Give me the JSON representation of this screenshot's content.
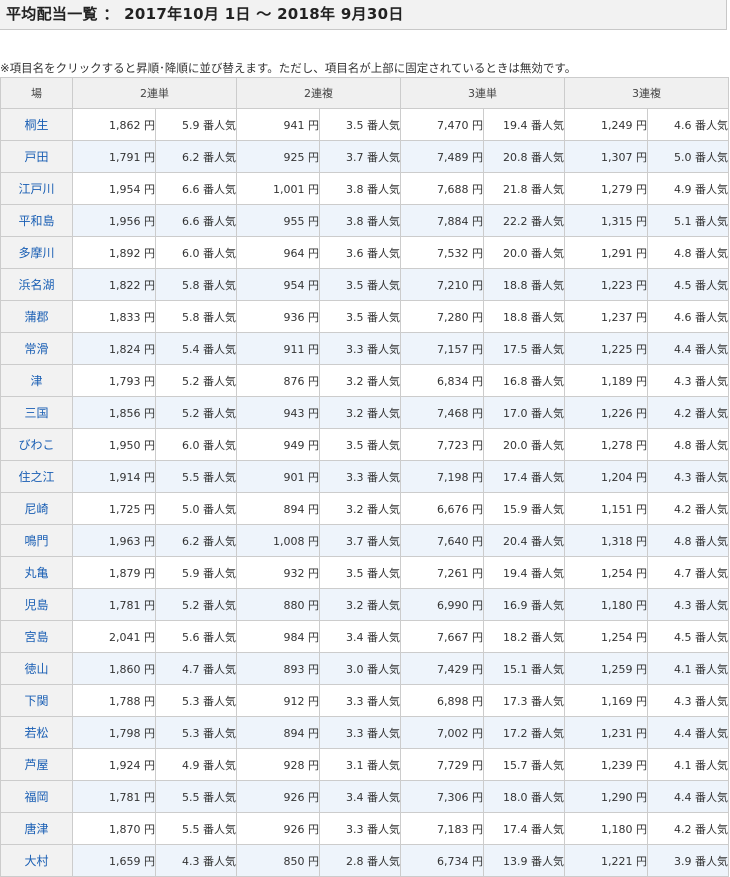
{
  "page": {
    "title": "平均配当一覧 ： 2017年10月 1日 ～ 2018年 9月30日",
    "note": "※項目名をクリックすると昇順･降順に並び替えます。ただし、項目名が上部に固定されているときは無効です。"
  },
  "table": {
    "headers": {
      "venue": "場",
      "t2": "2連単",
      "f2": "2連複",
      "t3": "3連単",
      "f3": "3連複"
    },
    "yen": "円",
    "pop_suffix": "番人気",
    "rows": [
      {
        "venue": "桐生",
        "t2_amt": "1,862",
        "t2_pop": "5.9",
        "f2_amt": "941",
        "f2_pop": "3.5",
        "t3_amt": "7,470",
        "t3_pop": "19.4",
        "f3_amt": "1,249",
        "f3_pop": "4.6"
      },
      {
        "venue": "戸田",
        "t2_amt": "1,791",
        "t2_pop": "6.2",
        "f2_amt": "925",
        "f2_pop": "3.7",
        "t3_amt": "7,489",
        "t3_pop": "20.8",
        "f3_amt": "1,307",
        "f3_pop": "5.0"
      },
      {
        "venue": "江戸川",
        "t2_amt": "1,954",
        "t2_pop": "6.6",
        "f2_amt": "1,001",
        "f2_pop": "3.8",
        "t3_amt": "7,688",
        "t3_pop": "21.8",
        "f3_amt": "1,279",
        "f3_pop": "4.9"
      },
      {
        "venue": "平和島",
        "t2_amt": "1,956",
        "t2_pop": "6.6",
        "f2_amt": "955",
        "f2_pop": "3.8",
        "t3_amt": "7,884",
        "t3_pop": "22.2",
        "f3_amt": "1,315",
        "f3_pop": "5.1"
      },
      {
        "venue": "多摩川",
        "t2_amt": "1,892",
        "t2_pop": "6.0",
        "f2_amt": "964",
        "f2_pop": "3.6",
        "t3_amt": "7,532",
        "t3_pop": "20.0",
        "f3_amt": "1,291",
        "f3_pop": "4.8"
      },
      {
        "venue": "浜名湖",
        "t2_amt": "1,822",
        "t2_pop": "5.8",
        "f2_amt": "954",
        "f2_pop": "3.5",
        "t3_amt": "7,210",
        "t3_pop": "18.8",
        "f3_amt": "1,223",
        "f3_pop": "4.5"
      },
      {
        "venue": "蒲郡",
        "t2_amt": "1,833",
        "t2_pop": "5.8",
        "f2_amt": "936",
        "f2_pop": "3.5",
        "t3_amt": "7,280",
        "t3_pop": "18.8",
        "f3_amt": "1,237",
        "f3_pop": "4.6"
      },
      {
        "venue": "常滑",
        "t2_amt": "1,824",
        "t2_pop": "5.4",
        "f2_amt": "911",
        "f2_pop": "3.3",
        "t3_amt": "7,157",
        "t3_pop": "17.5",
        "f3_amt": "1,225",
        "f3_pop": "4.4"
      },
      {
        "venue": "津",
        "t2_amt": "1,793",
        "t2_pop": "5.2",
        "f2_amt": "876",
        "f2_pop": "3.2",
        "t3_amt": "6,834",
        "t3_pop": "16.8",
        "f3_amt": "1,189",
        "f3_pop": "4.3"
      },
      {
        "venue": "三国",
        "t2_amt": "1,856",
        "t2_pop": "5.2",
        "f2_amt": "943",
        "f2_pop": "3.2",
        "t3_amt": "7,468",
        "t3_pop": "17.0",
        "f3_amt": "1,226",
        "f3_pop": "4.2"
      },
      {
        "venue": "びわこ",
        "t2_amt": "1,950",
        "t2_pop": "6.0",
        "f2_amt": "949",
        "f2_pop": "3.5",
        "t3_amt": "7,723",
        "t3_pop": "20.0",
        "f3_amt": "1,278",
        "f3_pop": "4.8"
      },
      {
        "venue": "住之江",
        "t2_amt": "1,914",
        "t2_pop": "5.5",
        "f2_amt": "901",
        "f2_pop": "3.3",
        "t3_amt": "7,198",
        "t3_pop": "17.4",
        "f3_amt": "1,204",
        "f3_pop": "4.3"
      },
      {
        "venue": "尼崎",
        "t2_amt": "1,725",
        "t2_pop": "5.0",
        "f2_amt": "894",
        "f2_pop": "3.2",
        "t3_amt": "6,676",
        "t3_pop": "15.9",
        "f3_amt": "1,151",
        "f3_pop": "4.2"
      },
      {
        "venue": "鳴門",
        "t2_amt": "1,963",
        "t2_pop": "6.2",
        "f2_amt": "1,008",
        "f2_pop": "3.7",
        "t3_amt": "7,640",
        "t3_pop": "20.4",
        "f3_amt": "1,318",
        "f3_pop": "4.8"
      },
      {
        "venue": "丸亀",
        "t2_amt": "1,879",
        "t2_pop": "5.9",
        "f2_amt": "932",
        "f2_pop": "3.5",
        "t3_amt": "7,261",
        "t3_pop": "19.4",
        "f3_amt": "1,254",
        "f3_pop": "4.7"
      },
      {
        "venue": "児島",
        "t2_amt": "1,781",
        "t2_pop": "5.2",
        "f2_amt": "880",
        "f2_pop": "3.2",
        "t3_amt": "6,990",
        "t3_pop": "16.9",
        "f3_amt": "1,180",
        "f3_pop": "4.3"
      },
      {
        "venue": "宮島",
        "t2_amt": "2,041",
        "t2_pop": "5.6",
        "f2_amt": "984",
        "f2_pop": "3.4",
        "t3_amt": "7,667",
        "t3_pop": "18.2",
        "f3_amt": "1,254",
        "f3_pop": "4.5"
      },
      {
        "venue": "徳山",
        "t2_amt": "1,860",
        "t2_pop": "4.7",
        "f2_amt": "893",
        "f2_pop": "3.0",
        "t3_amt": "7,429",
        "t3_pop": "15.1",
        "f3_amt": "1,259",
        "f3_pop": "4.1"
      },
      {
        "venue": "下関",
        "t2_amt": "1,788",
        "t2_pop": "5.3",
        "f2_amt": "912",
        "f2_pop": "3.3",
        "t3_amt": "6,898",
        "t3_pop": "17.3",
        "f3_amt": "1,169",
        "f3_pop": "4.3"
      },
      {
        "venue": "若松",
        "t2_amt": "1,798",
        "t2_pop": "5.3",
        "f2_amt": "894",
        "f2_pop": "3.3",
        "t3_amt": "7,002",
        "t3_pop": "17.2",
        "f3_amt": "1,231",
        "f3_pop": "4.4"
      },
      {
        "venue": "芦屋",
        "t2_amt": "1,924",
        "t2_pop": "4.9",
        "f2_amt": "928",
        "f2_pop": "3.1",
        "t3_amt": "7,729",
        "t3_pop": "15.7",
        "f3_amt": "1,239",
        "f3_pop": "4.1"
      },
      {
        "venue": "福岡",
        "t2_amt": "1,781",
        "t2_pop": "5.5",
        "f2_amt": "926",
        "f2_pop": "3.4",
        "t3_amt": "7,306",
        "t3_pop": "18.0",
        "f3_amt": "1,290",
        "f3_pop": "4.4"
      },
      {
        "venue": "唐津",
        "t2_amt": "1,870",
        "t2_pop": "5.5",
        "f2_amt": "926",
        "f2_pop": "3.3",
        "t3_amt": "7,183",
        "t3_pop": "17.4",
        "f3_amt": "1,180",
        "f3_pop": "4.2"
      },
      {
        "venue": "大村",
        "t2_amt": "1,659",
        "t2_pop": "4.3",
        "f2_amt": "850",
        "f2_pop": "2.8",
        "t3_amt": "6,734",
        "t3_pop": "13.9",
        "f3_amt": "1,221",
        "f3_pop": "3.9"
      }
    ]
  },
  "colors": {
    "link": "#1a5fb4",
    "header_bg": "#f0f0f0",
    "stripe": "#eef4fb",
    "border": "#cccccc"
  }
}
